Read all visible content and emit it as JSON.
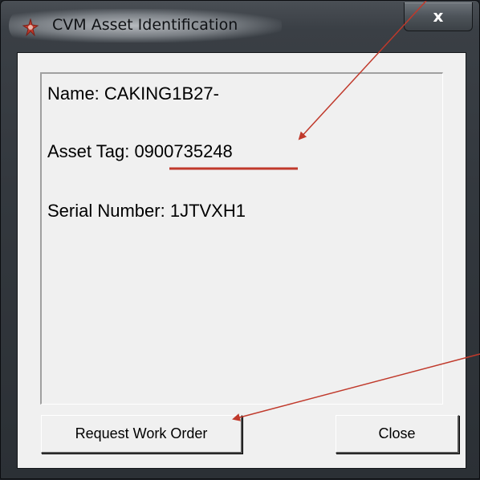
{
  "window": {
    "title": "CVM Asset Identification",
    "close_glyph": "x"
  },
  "info": {
    "name_line": "Name: CAKING1B27-",
    "asset_tag_label": "Asset Tag: ",
    "asset_tag_value": "0900735248",
    "serial_line": "Serial Number: 1JTVXH1"
  },
  "buttons": {
    "request_work_order": "Request Work Order",
    "close": "Close"
  },
  "annotation": {
    "arrow_color": "#c0392b",
    "underline_color": "#c0392b"
  }
}
